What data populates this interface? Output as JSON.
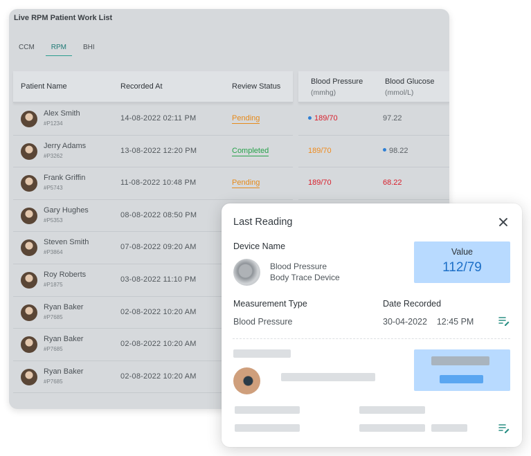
{
  "worklist": {
    "title": "Live RPM Patient Work List",
    "tabs": [
      {
        "label": "CCM",
        "active": false
      },
      {
        "label": "RPM",
        "active": true
      },
      {
        "label": "BHI",
        "active": false
      }
    ],
    "columns": {
      "patient_name": "Patient Name",
      "recorded_at": "Recorded At",
      "review_status": "Review Status",
      "blood_pressure": "Blood Pressure",
      "blood_pressure_unit": "(mmhg)",
      "blood_glucose": "Blood Glucose",
      "blood_glucose_unit": "(mmol/L)"
    },
    "rows": [
      {
        "name": "Alex Smith",
        "id": "#P1234",
        "recorded": "14-08-2022  02:11 PM",
        "status": "Pending",
        "bp": "189/70",
        "bg": "97.22"
      },
      {
        "name": "Jerry Adams",
        "id": "#P3262",
        "recorded": "13-08-2022  12:20 PM",
        "status": "Completed",
        "bp": "189/70",
        "bg": "98.22"
      },
      {
        "name": "Frank Griffin",
        "id": "#P5743",
        "recorded": "11-08-2022  10:48 PM",
        "status": "Pending",
        "bp": "189/70",
        "bg": "68.22"
      },
      {
        "name": "Gary Hughes",
        "id": "#P5353",
        "recorded": "08-08-2022  08:50 PM"
      },
      {
        "name": "Steven Smith",
        "id": "#P3864",
        "recorded": "07-08-2022  09:20 AM"
      },
      {
        "name": "Roy Roberts",
        "id": "#P1875",
        "recorded": "03-08-2022  11:10 PM"
      },
      {
        "name": "Ryan Baker",
        "id": "#P7685",
        "recorded": "02-08-2022  10:20 AM"
      },
      {
        "name": "Ryan Baker",
        "id": "#P7685",
        "recorded": "02-08-2022  10:20 AM"
      },
      {
        "name": "Ryan Baker",
        "id": "#P7685",
        "recorded": "02-08-2022  10:20 AM"
      }
    ]
  },
  "popup": {
    "title": "Last Reading",
    "device_name_label": "Device Name",
    "device_name_line1": "Blood Pressure",
    "device_name_line2": "Body Trace Device",
    "value_label": "Value",
    "value": "112/79",
    "measurement_type_label": "Measurement Type",
    "measurement_type": "Blood Pressure",
    "date_recorded_label": "Date Recorded",
    "date_recorded": "30-04-2022    12:45 PM"
  },
  "colors": {
    "accent": "#2a9d8f",
    "pending": "#e68a1a",
    "completed": "#27a14a",
    "high_reading": "#d81e2b",
    "value_box": "#b8daff",
    "value_text": "#1c6fc7"
  },
  "icons": [
    "close-icon",
    "edit-icon",
    "blood-pressure-device-icon",
    "smartwatch-icon",
    "avatar"
  ]
}
